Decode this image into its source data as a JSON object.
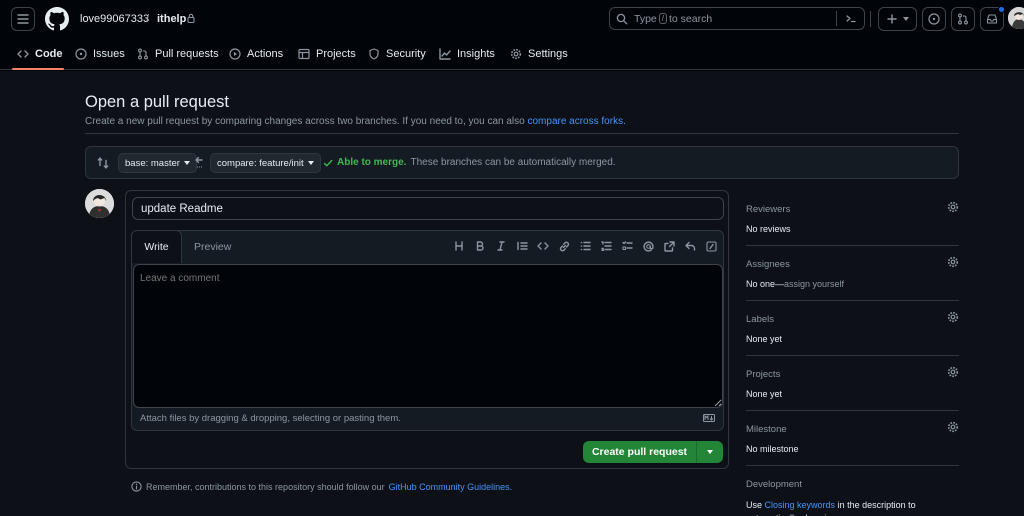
{
  "header": {
    "owner": "love99067333",
    "separator": "/",
    "repo": "ithelp",
    "search": {
      "prefix": "Type",
      "key": "/",
      "suffix": "to search"
    }
  },
  "nav": {
    "tabs": [
      {
        "label": "Code",
        "icon": "code-icon",
        "active": true
      },
      {
        "label": "Issues",
        "icon": "issue-icon"
      },
      {
        "label": "Pull requests",
        "icon": "pull-request-icon"
      },
      {
        "label": "Actions",
        "icon": "play-icon"
      },
      {
        "label": "Projects",
        "icon": "table-icon"
      },
      {
        "label": "Security",
        "icon": "shield-icon"
      },
      {
        "label": "Insights",
        "icon": "graph-icon"
      },
      {
        "label": "Settings",
        "icon": "gear-icon"
      }
    ]
  },
  "page": {
    "title": "Open a pull request",
    "subtitle": "Create a new pull request by comparing changes across two branches. If you need to, you can also",
    "subtitle_link": "compare across forks."
  },
  "compare": {
    "base_label": "base: master",
    "compare_label": "compare: feature/init",
    "merge_ok": "Able to merge.",
    "merge_text": "These branches can be automatically merged."
  },
  "form": {
    "title_value": "update Readme",
    "tab_write": "Write",
    "tab_preview": "Preview",
    "comment_placeholder": "Leave a comment",
    "attach_text": "Attach files by dragging & dropping, selecting or pasting them.",
    "submit_label": "Create pull request"
  },
  "note": {
    "text": "Remember, contributions to this repository should follow our",
    "link": "GitHub Community Guidelines."
  },
  "sidebar": {
    "reviewers": {
      "title": "Reviewers",
      "value": "No reviews"
    },
    "assignees": {
      "title": "Assignees",
      "value": "No one—",
      "link": "assign yourself"
    },
    "labels": {
      "title": "Labels",
      "value": "None yet"
    },
    "projects": {
      "title": "Projects",
      "value": "None yet"
    },
    "milestone": {
      "title": "Milestone",
      "value": "No milestone"
    },
    "development": {
      "title": "Development",
      "prefix": "Use",
      "link": "Closing keywords",
      "suffix": "in the description to automatically close issues"
    }
  },
  "colors": {
    "accent": "#4493f8",
    "success": "#238636",
    "success_text": "#3fb950",
    "tab_underline": "#f78166",
    "background": "#0d1117"
  }
}
